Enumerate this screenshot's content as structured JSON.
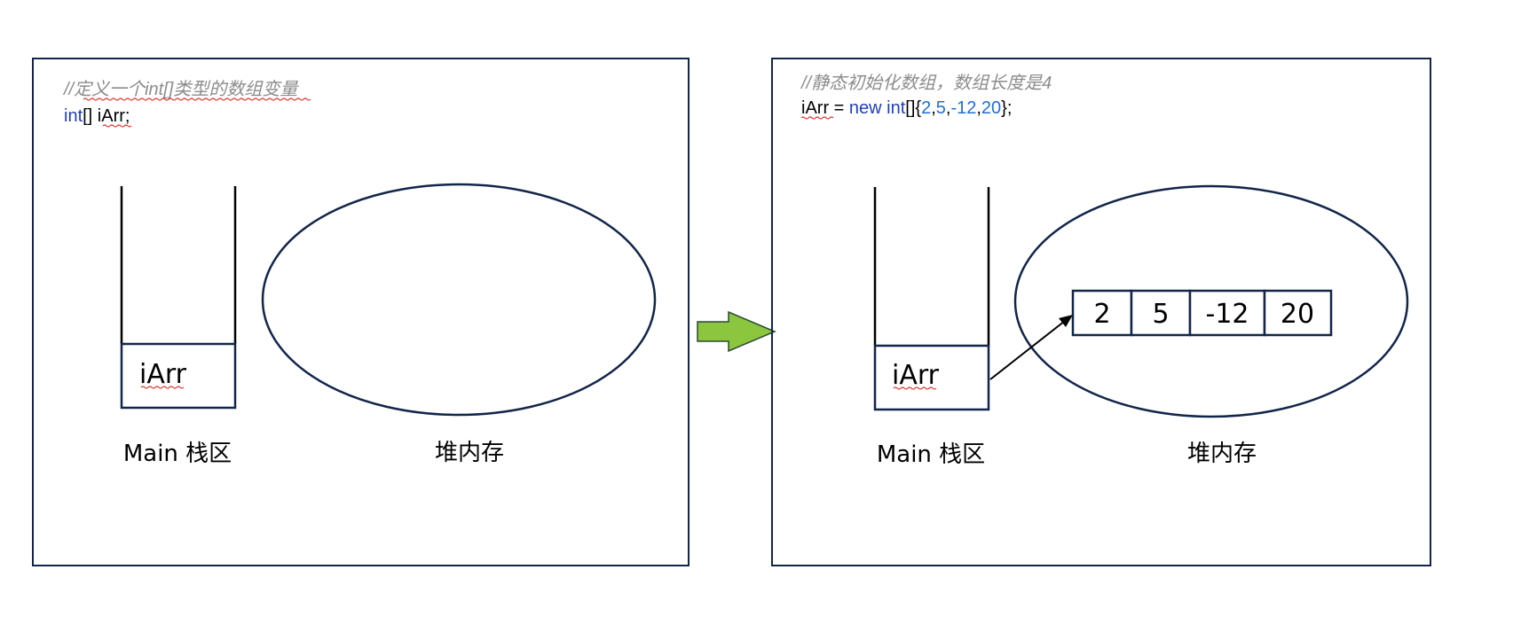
{
  "colors": {
    "frame": "#12254a",
    "keyword": "#1f3fbf",
    "number": "#1f6fd1",
    "comment": "#8c8c8c",
    "arrow_fill": "#8cc63f",
    "arrow_stroke": "#2b4a33",
    "spell_underline": "#e0302a"
  },
  "left_panel": {
    "comment": "//定义一个int[]类型的数组变量",
    "code": {
      "type_kw": "int",
      "rest": "[] iArr;"
    },
    "stack_var": "iArr",
    "stack_label": "Main 栈区",
    "heap_label": "堆内存"
  },
  "right_panel": {
    "comment": "//静态初始化数组，数组长度是4",
    "code": {
      "var": "iArr",
      "assign": " = ",
      "new_kw": "new int",
      "brace_open": "[]{",
      "values": [
        "2",
        "5",
        "-12",
        "20"
      ],
      "sep": ",",
      "brace_close": "};"
    },
    "stack_var": "iArr",
    "stack_label": "Main 栈区",
    "heap_label": "堆内存",
    "array_cells": [
      "2",
      "5",
      "-12",
      "20"
    ]
  },
  "transition_arrow": "block-arrow-right-icon"
}
